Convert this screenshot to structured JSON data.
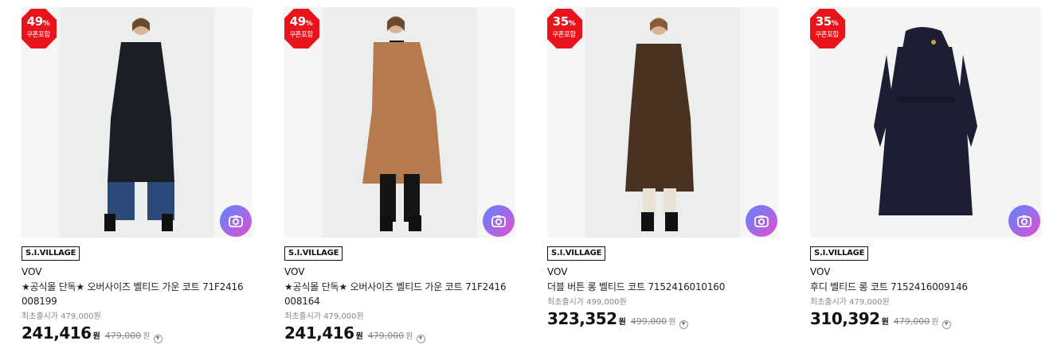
{
  "colors": {
    "discount_badge": "#e8131b",
    "camera_gradient_start": "#5a86ff",
    "camera_gradient_end": "#e24fd0",
    "text_primary": "#111111",
    "text_muted": "#888888"
  },
  "products": [
    {
      "discount": "49",
      "discount_sign": "%",
      "coupon_note": "쿠폰포함",
      "seller_label": "S.I.VILLAGE",
      "brand": "VOV",
      "name_line1": "★공식몰 단독★ 오버사이즈 벨티드 가운 코트 71F2416",
      "name_line2": "008199",
      "orig_label": "최초출시가 479,000원",
      "sale_price": "241,416",
      "won": "원",
      "orig_price": "479,000",
      "won_suffix": "원",
      "coat_color": "#1b1e24",
      "icon": "camera-icon"
    },
    {
      "discount": "49",
      "discount_sign": "%",
      "coupon_note": "쿠폰포함",
      "seller_label": "S.I.VILLAGE",
      "brand": "VOV",
      "name_line1": "★공식몰 단독★ 오버사이즈 벨티드 가운 코트 71F2416",
      "name_line2": "008164",
      "orig_label": "최초출시가 479,000원",
      "sale_price": "241,416",
      "won": "원",
      "orig_price": "479,000",
      "won_suffix": "원",
      "coat_color": "#b57a4e",
      "icon": "camera-icon"
    },
    {
      "discount": "35",
      "discount_sign": "%",
      "coupon_note": "쿠폰포함",
      "seller_label": "S.I.VILLAGE",
      "brand": "VOV",
      "name_line1": "더블 버튼 롱 벨티드 코트 7152416010160",
      "name_line2": "",
      "orig_label": "최초출시가 499,000원",
      "sale_price": "323,352",
      "won": "원",
      "orig_price": "499,000",
      "won_suffix": "원",
      "coat_color": "#4a3222",
      "icon": "camera-icon"
    },
    {
      "discount": "35",
      "discount_sign": "%",
      "coupon_note": "쿠폰포함",
      "seller_label": "S.I.VILLAGE",
      "brand": "VOV",
      "name_line1": "후디 벨티드 롱 코트 7152416009146",
      "name_line2": "",
      "orig_label": "최초출시가 479,000원",
      "sale_price": "310,392",
      "won": "원",
      "orig_price": "479,000",
      "won_suffix": "원",
      "coat_color": "#1c1f33",
      "icon": "camera-icon"
    }
  ]
}
